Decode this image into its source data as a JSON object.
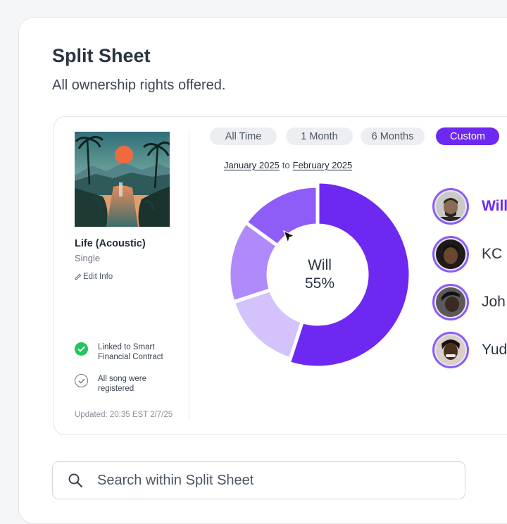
{
  "header": {
    "title": "Split Sheet",
    "subtitle": "All ownership rights offered."
  },
  "song": {
    "title": "Life (Acoustic)",
    "type": "Single",
    "edit_label": "Edit Info",
    "statuses": [
      {
        "line1": "Linked to Smart",
        "line2": "Financial Contract",
        "state": "checked",
        "color": "#22c55e"
      },
      {
        "line1": "All song were",
        "line2": "registered",
        "state": "unchecked",
        "color": "#6b7280"
      }
    ],
    "updated": "Updated: 20:35 EST 2/7/25"
  },
  "tabs": [
    {
      "label": "All Time",
      "active": false
    },
    {
      "label": "1 Month",
      "active": false
    },
    {
      "label": "6 Months",
      "active": false
    },
    {
      "label": "Custom",
      "active": true
    }
  ],
  "date_range": {
    "from": "January 2025",
    "connector": "to",
    "to": "February 2025"
  },
  "chart_data": {
    "type": "pie",
    "center_name": "Will",
    "center_value": "55%",
    "slices": [
      {
        "name": "Will",
        "value": 55,
        "color": "#6d28f2"
      },
      {
        "name": "KC",
        "value": 15,
        "color": "#d4c2fc"
      },
      {
        "name": "John",
        "value": 15,
        "color": "#b08afa"
      },
      {
        "name": "Yudi",
        "value": 15,
        "color": "#8e5cf7"
      }
    ]
  },
  "people": [
    {
      "name": "Will",
      "active": true
    },
    {
      "name": "KC",
      "active": false
    },
    {
      "name": "Joh",
      "active": false
    },
    {
      "name": "Yud",
      "active": false
    }
  ],
  "search": {
    "placeholder": "Search within Split Sheet"
  },
  "colors": {
    "accent": "#6d28f2",
    "avatar_ring": "#8b5cf6"
  },
  "icons": {
    "search": "search-icon",
    "edit": "pencil-icon",
    "status_checked": "check-circle-icon",
    "status_unchecked": "check-circle-outline-icon",
    "cursor": "mouse-pointer-icon"
  }
}
